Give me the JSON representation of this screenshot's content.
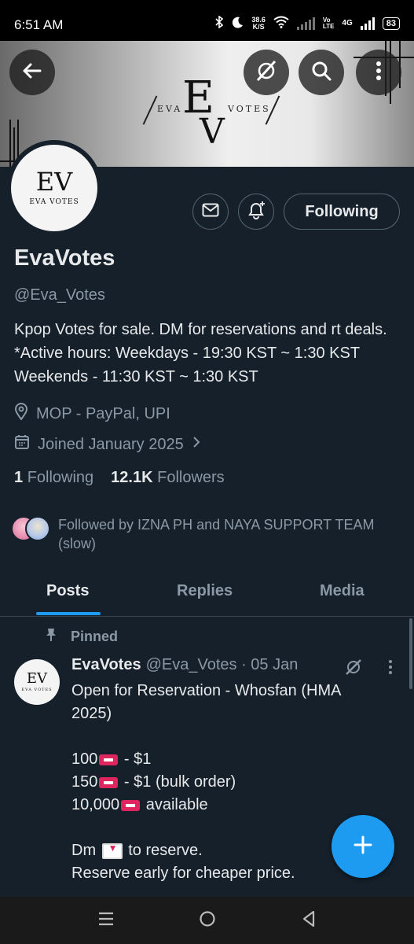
{
  "status_bar": {
    "time": "6:51 AM",
    "net_speed": "38.6",
    "net_unit": "K/S",
    "volte_top": "Vo",
    "volte_bottom": "LTE",
    "network": "4G",
    "battery": "83"
  },
  "banner": {
    "left_word": "EVA",
    "right_word": "VOTES",
    "mono_e": "E",
    "mono_v": "V"
  },
  "profile": {
    "avatar_mark": "EV",
    "avatar_text": "EVA VOTES",
    "name": "EvaVotes",
    "handle": "@Eva_Votes",
    "bio": "Kpop Votes for sale. DM for reservations and rt deals. *Active hours: Weekdays - 19:30 KST ~ 1:30 KST Weekends - 11:30 KST ~ 1:30 KST",
    "location": "MOP - PayPal, UPI",
    "joined": "Joined January 2025",
    "following_count": "1",
    "following_label": "Following",
    "followers_count": "12.1K",
    "followers_label": "Followers",
    "followed_by": "Followed by IZNA PH and NAYA SUPPORT TEAM (slow)",
    "follow_button": "Following"
  },
  "tabs": [
    {
      "label": "Posts",
      "active": true
    },
    {
      "label": "Replies",
      "active": false
    },
    {
      "label": "Media",
      "active": false
    }
  ],
  "pinned_tweet": {
    "pinned_label": "Pinned",
    "author": "EvaVotes",
    "handle_date": "@Eva_Votes · 05 Jan",
    "line1": "Open for Reservation - Whosfan (HMA",
    "line2": "2025)",
    "item1_qty": "100",
    "item1_price": " - $1",
    "item2_qty": "150",
    "item2_price": " - $1 (bulk order)",
    "item3_qty": "10,000",
    "item3_price": " available",
    "dm_pre": "Dm ",
    "dm_post": " to reserve.",
    "last_line": "Reserve early for cheaper price."
  },
  "colors": {
    "background": "#15202b",
    "accent": "#1d9bf0",
    "muted": "#8b98a5"
  }
}
